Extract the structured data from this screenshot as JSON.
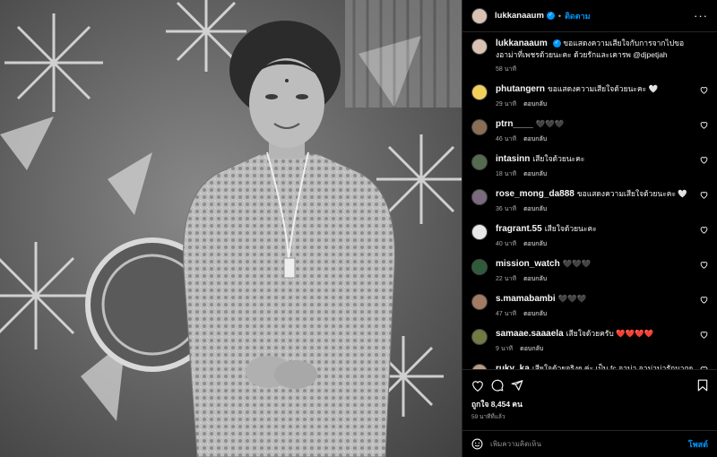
{
  "header": {
    "username": "lukkanaaum",
    "verified_mark": "✓",
    "separator": "•",
    "follow_label": "ติดตาม",
    "more_label": "···"
  },
  "caption": {
    "username": "lukkanaaum",
    "text": "ขอแสดงความเสียใจกับการจากไปของอาม่าที่เพชรด้วยนะคะ ด้วยรักและเคารพ @djpetjah",
    "time": "58 นาที"
  },
  "reply_label": "ตอบกลับ",
  "comments": [
    {
      "username": "phutangern",
      "text": "ขอแสดงความเสียใจด้วยนะคะ 🤍",
      "time": "29 นาที",
      "avatar_color": "#f2d15a"
    },
    {
      "username": "ptrn____",
      "text": "🖤🖤🖤",
      "time": "46 นาที",
      "avatar_color": "#8a6d55"
    },
    {
      "username": "intasinn",
      "text": "เสียใจด้วยนะคะ",
      "time": "18 นาที",
      "avatar_color": "#556b4f"
    },
    {
      "username": "rose_mong_da888",
      "text": "ขอแสดงความเสียใจด้วยนะคะ 🤍",
      "time": "36 นาที",
      "avatar_color": "#7a6a7e"
    },
    {
      "username": "fragrant.55",
      "text": "เสียใจด้วยนะคะ",
      "time": "40 นาที",
      "avatar_color": "#e8e8e8"
    },
    {
      "username": "mission_watch",
      "text": "🖤🖤🖤",
      "time": "22 นาที",
      "avatar_color": "#2f5b3a"
    },
    {
      "username": "s.mamabambi",
      "text": "🖤🖤🖤",
      "time": "47 นาที",
      "avatar_color": "#a37a62"
    },
    {
      "username": "samaae.saaaela",
      "text": "เสียใจด้วยครับ ❤️❤️❤️❤️",
      "time": "9 นาที",
      "avatar_color": "#6f7a45"
    },
    {
      "username": "ruky_ka",
      "text": "เสียใจด้วยจริงๆ ค่ะ เป็น fc อาม่า อาม่าน่ารักมากๆ",
      "time": "",
      "avatar_color": "#b89b86"
    }
  ],
  "actions": {
    "likes_text": "ถูกใจ 8,454 คน",
    "time_text": "59 นาทีที่แล้ว"
  },
  "add_comment": {
    "placeholder": "เพิ่มความคิดเห็น",
    "post_label": "โพสต์"
  },
  "colors": {
    "accent": "#0095f6",
    "panel_bg": "#000000",
    "divider": "#262626"
  },
  "icons": {
    "like": "heart-icon",
    "comment": "comment-icon",
    "share": "share-icon",
    "save": "bookmark-icon",
    "emoji": "emoji-icon"
  }
}
